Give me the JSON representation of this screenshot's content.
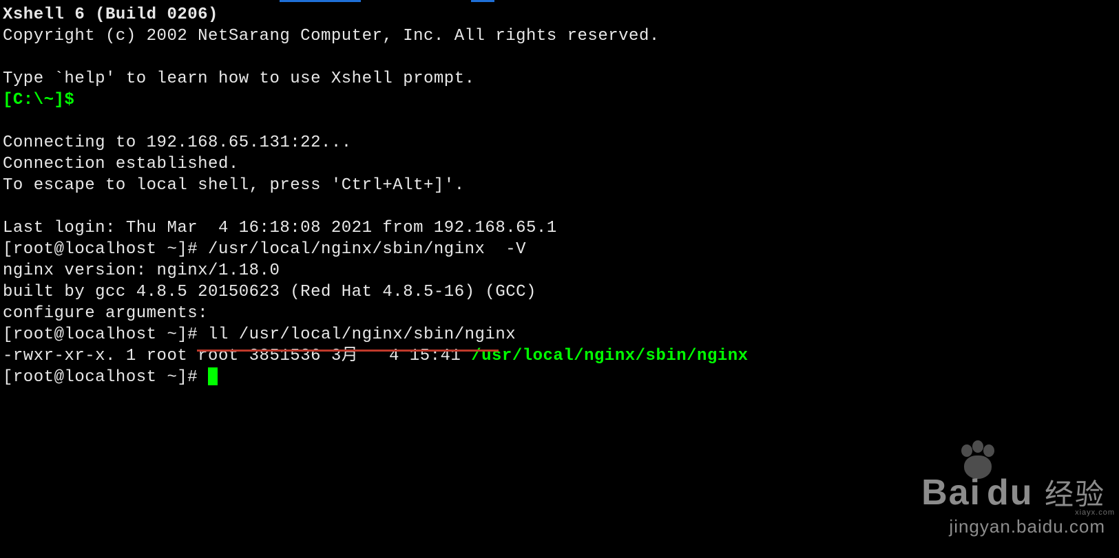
{
  "banner": {
    "title": "Xshell 6 (Build 0206)",
    "copyright": "Copyright (c) 2002 NetSarang Computer, Inc. All rights reserved.",
    "help_line": "Type `help' to learn how to use Xshell prompt.",
    "local_prompt": "[C:\\~]$"
  },
  "connect": {
    "connecting": "Connecting to 192.168.65.131:22...",
    "established": "Connection established.",
    "escape": "To escape to local shell, press 'Ctrl+Alt+]'."
  },
  "session": {
    "last_login": "Last login: Thu Mar  4 16:18:08 2021 from 192.168.65.1",
    "prompt": "[root@localhost ~]# ",
    "cmd_version": "/usr/local/nginx/sbin/nginx  -V",
    "nginx_version": "nginx version: nginx/1.18.0",
    "built_by": "built by gcc 4.8.5 20150623 (Red Hat 4.8.5-16) (GCC)",
    "configure": "configure arguments:",
    "cmd_ll": "ll /usr/local/nginx/sbin/nginx",
    "ll_out_left": "-rwxr-xr-x. 1 root root 3851536 3月   4 15:41 ",
    "ll_out_path": "/usr/local/nginx/sbin/nginx"
  },
  "watermark": {
    "brand": "Bai",
    "brand2": "du",
    "suffix": "经验",
    "url": "jingyan.baidu.com",
    "side": "xiayx.com"
  },
  "colors": {
    "green": "#00ff00",
    "underline": "#c0392b",
    "top_blue": "#1e6fd6"
  }
}
